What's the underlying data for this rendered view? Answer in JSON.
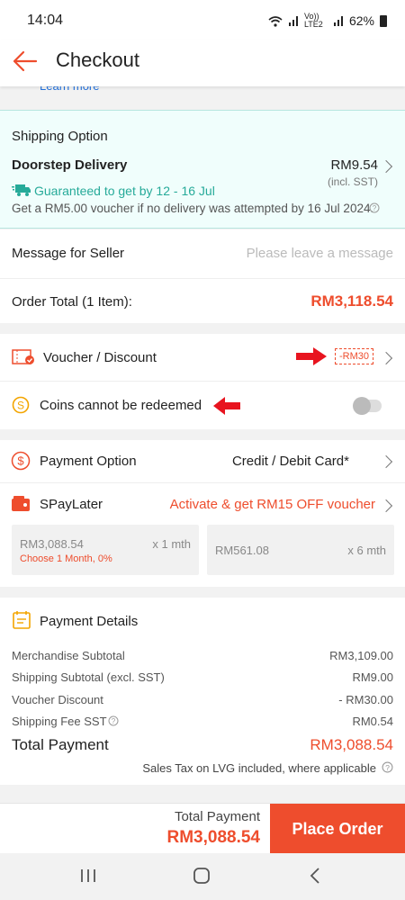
{
  "status": {
    "time": "14:04",
    "battery": "62%",
    "lte": "Vo)) LTE2"
  },
  "header": {
    "title": "Checkout"
  },
  "learn_more": "Learn more",
  "shipping": {
    "section_title": "Shipping Option",
    "method": "Doorstep Delivery",
    "price": "RM9.54",
    "price_note": "(incl. SST)",
    "guarantee": "Guaranteed to get by 12 - 16 Jul",
    "voucher_note": "Get a RM5.00 voucher if no delivery was attempted by 16 Jul 2024."
  },
  "message": {
    "label": "Message for Seller",
    "placeholder": "Please leave a message"
  },
  "order_total": {
    "label": "Order Total (1 Item):",
    "value": "RM3,118.54"
  },
  "voucher": {
    "label": "Voucher / Discount",
    "tag": "-RM30"
  },
  "coins": {
    "label": "Coins cannot be redeemed",
    "enabled": false
  },
  "payment": {
    "label": "Payment Option",
    "value": "Credit / Debit Card*"
  },
  "spaylater": {
    "label": "SPayLater",
    "promo": "Activate & get RM15 OFF voucher",
    "plans": [
      {
        "amount": "RM3,088.54",
        "term": "x 1 mth",
        "note": "Choose 1 Month, 0%"
      },
      {
        "amount": "RM561.08",
        "term": "x 6 mth",
        "note": ""
      }
    ]
  },
  "payment_details": {
    "title": "Payment Details",
    "rows": [
      {
        "label": "Merchandise Subtotal",
        "value": "RM3,109.00"
      },
      {
        "label": "Shipping Subtotal (excl. SST)",
        "value": "RM9.00"
      },
      {
        "label": "Voucher Discount",
        "value": "- RM30.00"
      },
      {
        "label": "Shipping Fee SST",
        "value": "RM0.54"
      }
    ],
    "total_label": "Total Payment",
    "total_value": "RM3,088.54",
    "tax_note": "Sales Tax on LVG included, where applicable"
  },
  "footer": {
    "total_label": "Total Payment",
    "total_value": "RM3,088.54",
    "button": "Place Order"
  },
  "colors": {
    "accent": "#ee4d2d",
    "green": "#26aa99",
    "link": "#2673dd"
  }
}
